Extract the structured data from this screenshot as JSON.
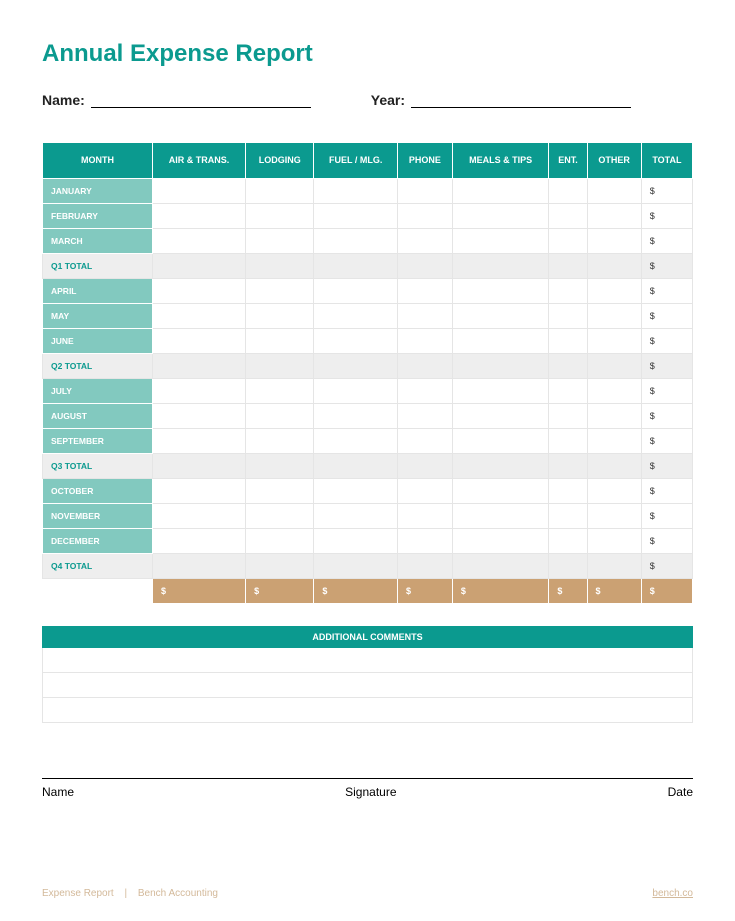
{
  "title": "Annual Expense Report",
  "name_label": "Name:",
  "year_label": "Year:",
  "columns": [
    "MONTH",
    "AIR & TRANS.",
    "LODGING",
    "FUEL / MLG.",
    "PHONE",
    "MEALS & TIPS",
    "ENT.",
    "OTHER",
    "TOTAL"
  ],
  "rows": [
    {
      "type": "month",
      "label": "JANUARY",
      "total": "$"
    },
    {
      "type": "month",
      "label": "FEBRUARY",
      "total": "$"
    },
    {
      "type": "month",
      "label": "MARCH",
      "total": "$"
    },
    {
      "type": "qtotal",
      "label": "Q1 TOTAL",
      "total": "$"
    },
    {
      "type": "month",
      "label": "APRIL",
      "total": "$"
    },
    {
      "type": "month",
      "label": "MAY",
      "total": "$"
    },
    {
      "type": "month",
      "label": "JUNE",
      "total": "$"
    },
    {
      "type": "qtotal",
      "label": "Q2 TOTAL",
      "total": "$"
    },
    {
      "type": "month",
      "label": "JULY",
      "total": "$"
    },
    {
      "type": "month",
      "label": "AUGUST",
      "total": "$"
    },
    {
      "type": "month",
      "label": "SEPTEMBER",
      "total": "$"
    },
    {
      "type": "qtotal",
      "label": "Q3 TOTAL",
      "total": "$"
    },
    {
      "type": "month",
      "label": "OCTOBER",
      "total": "$"
    },
    {
      "type": "month",
      "label": "NOVEMBER",
      "total": "$"
    },
    {
      "type": "month",
      "label": "DECEMBER",
      "total": "$"
    },
    {
      "type": "qtotal",
      "label": "Q4 TOTAL",
      "total": "$"
    }
  ],
  "grand_total_cells": [
    "",
    "$",
    "$",
    "$",
    "$",
    "$",
    "$",
    "$",
    "$"
  ],
  "comments_header": "ADDITIONAL COMMENTS",
  "sig_labels": {
    "name": "Name",
    "signature": "Signature",
    "date": "Date"
  },
  "footer": {
    "left1": "Expense Report",
    "left2": "Bench Accounting",
    "right": "bench.co"
  }
}
